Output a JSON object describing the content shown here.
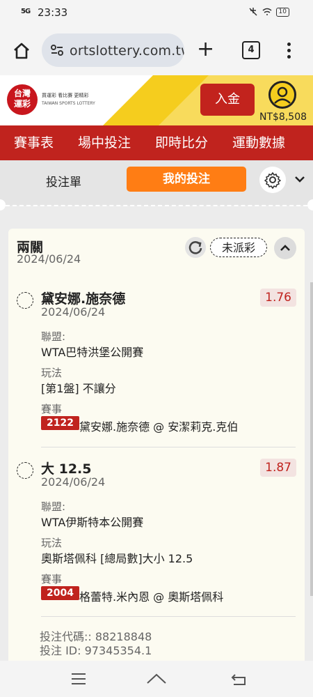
{
  "status_bar": {
    "signal": "5G",
    "time": "23:33",
    "battery": "10"
  },
  "browser": {
    "url": "ortslottery.com.tw",
    "tab_count": "4"
  },
  "site": {
    "logo_text": "台灣\n運彩",
    "logo_tagline": "買運彩 看比賽 更精彩",
    "logo_en": "TAIWAN SPORTS LOTTERY",
    "deposit_label": "入金",
    "balance": "NT$8,508"
  },
  "nav": {
    "items": [
      "賽事表",
      "場中投注",
      "即時比分",
      "運動數據"
    ]
  },
  "bet_tabs": {
    "slip": "投注單",
    "mine": "我的投注"
  },
  "card": {
    "title": "兩關",
    "date": "2024/06/24",
    "status": "未派彩",
    "legs": [
      {
        "selection": "黛安娜.施奈德",
        "odds": "1.76",
        "date": "2024/06/24",
        "league_label": "聯盟:",
        "league": "WTA巴特洪堡公開賽",
        "market_label": "玩法",
        "market": "[第1盤] 不讓分",
        "event_label": "賽事",
        "event_code": "2122",
        "event": "黛安娜.施奈德 @ 安潔莉克.克伯"
      },
      {
        "selection": "大 12.5",
        "odds": "1.87",
        "date": "2024/06/24",
        "league_label": "聯盟:",
        "league": "WTA伊斯特本公開賽",
        "market_label": "玩法",
        "market": "奧斯塔佩科 [總局數]大小 12.5",
        "event_label": "賽事",
        "event_code": "2004",
        "event": "格蕾特.米內恩 @ 奧斯塔佩科"
      }
    ],
    "bet_code": "投注代碼:: 88218848",
    "bet_id": "投注 ID: 97345354.1"
  },
  "colors": {
    "brand_red": "#c0231e",
    "accent_orange": "#ff7d14",
    "yellow": "#f5cd1e"
  }
}
